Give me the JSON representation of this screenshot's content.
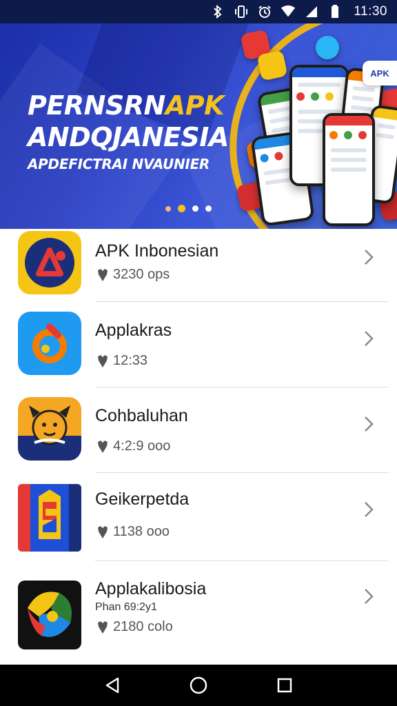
{
  "status_bar": {
    "time": "11:30",
    "icons": [
      "bluetooth-icon",
      "vibrate-icon",
      "alarm-icon",
      "wifi-icon",
      "signal-icon",
      "battery-icon"
    ]
  },
  "banner": {
    "title_line1_white": "PERNSRN",
    "title_line1_gold": "APK",
    "title_line2": "ANDQJANESIA",
    "subtitle": "APDEFICTRAI NVAUNIER",
    "badge": "APK",
    "carousel_pages": 4,
    "active_page": 2
  },
  "apps": [
    {
      "name": "APK Inbonesian",
      "meta": "3230 ops",
      "icon": "apk-logo-icon",
      "colors": [
        "#1b2e7a",
        "#f5c516",
        "#e53935"
      ]
    },
    {
      "name": "Applakras",
      "meta": "12:33",
      "icon": "app-logo-icon",
      "colors": [
        "#1e9bf0",
        "#f57c00",
        "#e53935"
      ]
    },
    {
      "name": "Cohbaluhan",
      "meta": "4:2:9 ooo",
      "icon": "mascot-icon",
      "colors": [
        "#f5a623",
        "#1b2e7a"
      ]
    },
    {
      "name": "Geikerpetda",
      "meta": "1138 ooo",
      "icon": "s-logo-icon",
      "colors": [
        "#e53935",
        "#1e4fd6",
        "#f5c516"
      ]
    },
    {
      "name": "Applakalibosia",
      "sub": "Phan 69:2y1",
      "meta": "2180 colo",
      "icon": "colorful-leaf-icon",
      "colors": [
        "#111111",
        "#f5c516",
        "#2e7d32",
        "#1e88e5"
      ]
    }
  ],
  "colors": {
    "banner_blue": "#2a3fc4",
    "accent_gold": "#f4c21f",
    "status_bar": "#0d1b4a",
    "nav_bar": "#000000"
  },
  "nav": {
    "buttons": [
      "back-icon",
      "home-icon",
      "recents-icon"
    ]
  }
}
